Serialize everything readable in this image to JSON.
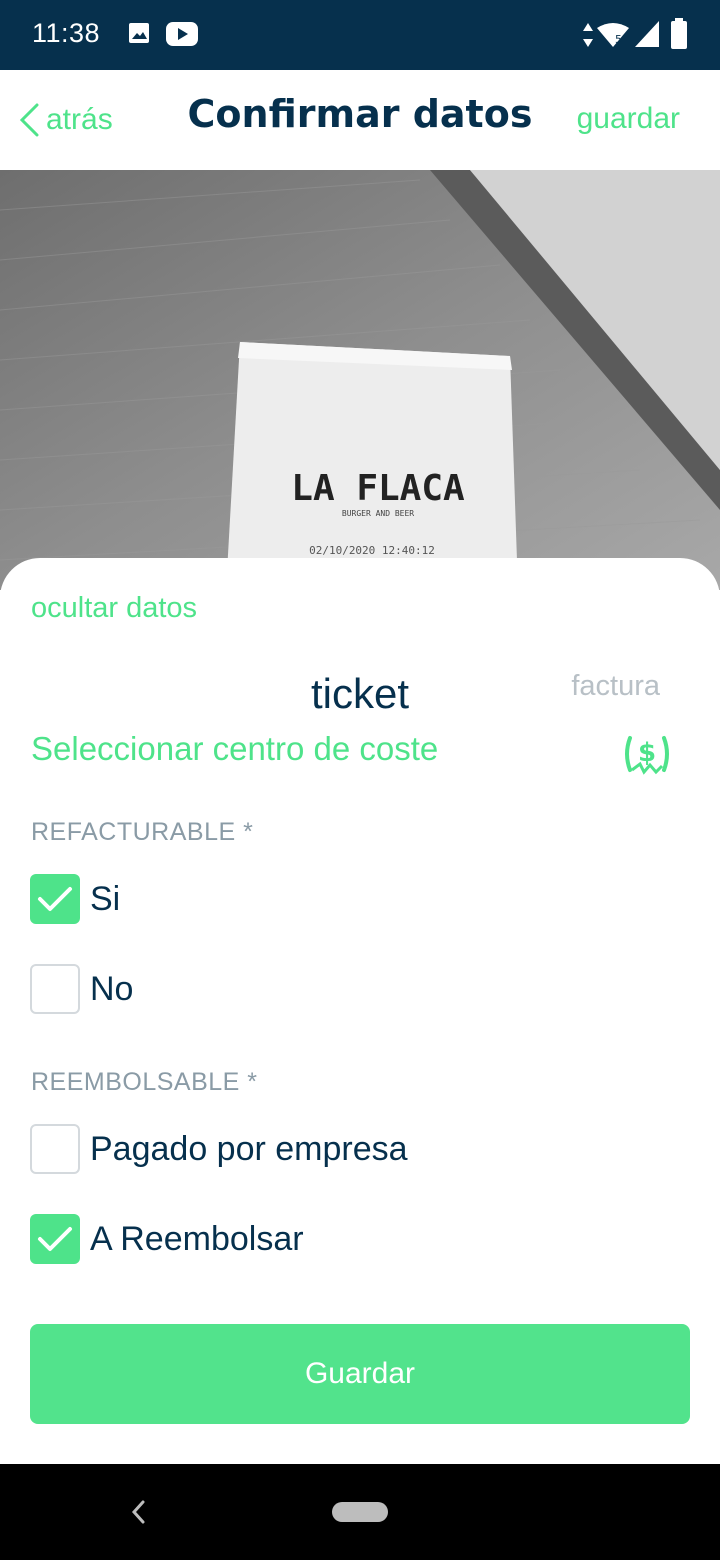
{
  "status_bar": {
    "time": "11:38",
    "icons": [
      "image-icon",
      "youtube-icon",
      "data-arrows-icon",
      "wifi-icon",
      "signal-icon",
      "battery-icon"
    ]
  },
  "header": {
    "back_label": "atrás",
    "title": "Confirmar datos",
    "save_label": "guardar"
  },
  "photo": {
    "receipt_brand": "LA FLACA",
    "receipt_subtitle": "BURGER AND BEER",
    "receipt_datetime": "02/10/2020 12:40:12"
  },
  "sheet": {
    "hide_data_label": "ocultar datos",
    "tabs": [
      {
        "label": "ticket",
        "selected": true
      },
      {
        "label": "factura",
        "selected": false
      }
    ],
    "cost_center_label": "Seleccionar centro de coste",
    "refacturable": {
      "label": "REFACTURABLE *",
      "options": [
        {
          "label": "Si",
          "checked": true
        },
        {
          "label": "No",
          "checked": false
        }
      ]
    },
    "reembolsable": {
      "label": "REEMBOLSABLE *",
      "options": [
        {
          "label": "Pagado por empresa",
          "checked": false
        },
        {
          "label": "A Reembolsar",
          "checked": true
        }
      ]
    },
    "save_button_label": "Guardar"
  },
  "colors": {
    "accent": "#4ee38a",
    "navy": "#06304d",
    "muted": "#8a9ba6"
  }
}
